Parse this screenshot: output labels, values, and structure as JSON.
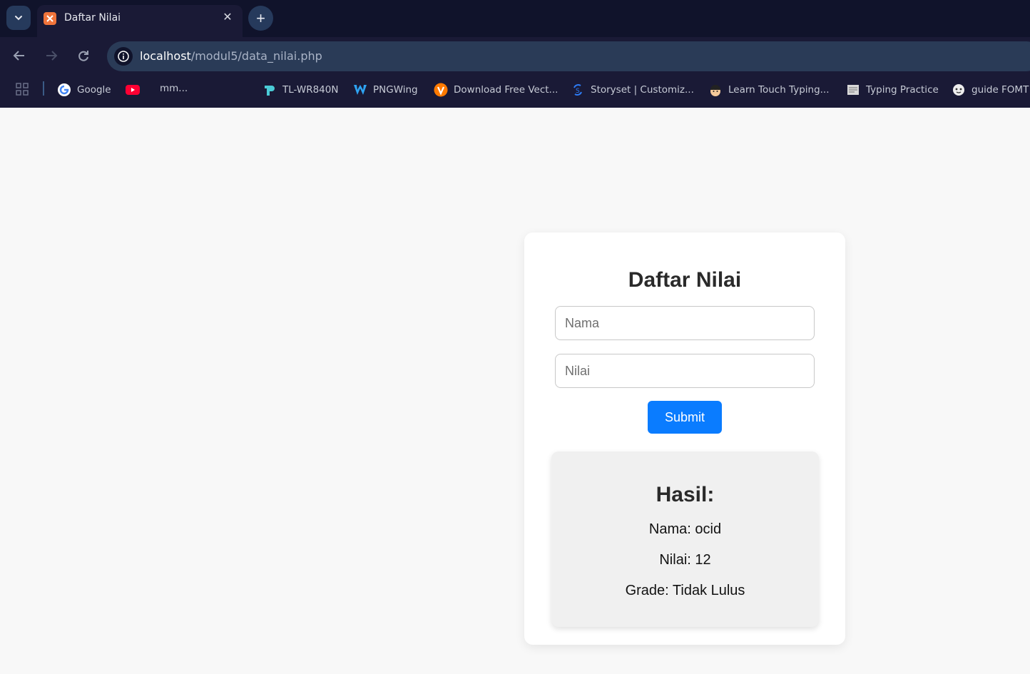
{
  "browser": {
    "tab": {
      "title": "Daftar Nilai",
      "favicon": "xampp-icon"
    },
    "url": {
      "host": "localhost",
      "path": "/modul5/data_nilai.php"
    },
    "bookmarks": [
      {
        "label": "Google",
        "icon": "google-icon"
      },
      {
        "label": "",
        "icon": "youtube-icon"
      },
      {
        "label": "mm...",
        "icon": ""
      },
      {
        "label": "TL-WR840N",
        "icon": "tplink-icon"
      },
      {
        "label": "PNGWing",
        "icon": "pngwing-icon"
      },
      {
        "label": "Download Free Vect...",
        "icon": "vecteezy-icon"
      },
      {
        "label": "Storyset | Customiz...",
        "icon": "storyset-icon"
      },
      {
        "label": "Learn Touch Typing...",
        "icon": "typing-icon"
      },
      {
        "label": "Typing Practice",
        "icon": "typing-practice-icon"
      },
      {
        "label": "guide FOMT",
        "icon": "fomt-icon"
      }
    ]
  },
  "form": {
    "title": "Daftar Nilai",
    "nama_placeholder": "Nama",
    "nilai_placeholder": "Nilai",
    "submit_label": "Submit"
  },
  "result": {
    "title": "Hasil:",
    "nama": "Nama: ocid",
    "nilai": "Nilai: 12",
    "grade": "Grade: Tidak Lulus"
  },
  "colors": {
    "accent": "#0a7cff",
    "chrome_dark": "#10132b",
    "chrome": "#1a1a36",
    "omnibox": "#2a3b57"
  }
}
